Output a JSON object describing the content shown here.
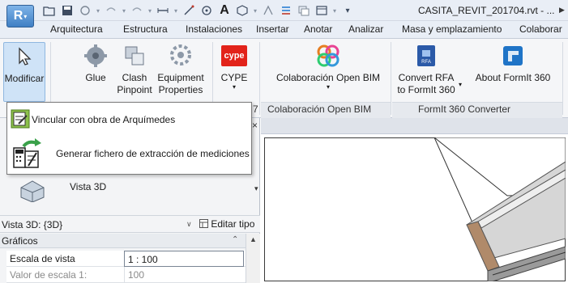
{
  "app": {
    "button_letter": "R",
    "title": "CASITA_REVIT_201704.rvt - ..."
  },
  "quick_access": {
    "icons": [
      "open-icon",
      "save-icon",
      "sync-icon",
      "undo-icon",
      "redo-icon",
      "measure-icon",
      "dimension-icon",
      "tag-icon",
      "text-icon",
      "3d-view-icon",
      "section-icon",
      "thin-lines-icon",
      "close-hidden-icon",
      "switch-windows-icon",
      "customize-icon"
    ],
    "text_tool_glyph": "A"
  },
  "tabs": [
    "Arquitectura",
    "Estructura",
    "Instalaciones",
    "Insertar",
    "Anotar",
    "Analizar",
    "Masa y emplazamiento",
    "Colaborar"
  ],
  "ribbon": {
    "modify": {
      "label": "Modificar"
    },
    "glue": {
      "label": "Glue"
    },
    "clash": {
      "line1": "Clash",
      "line2": "Pinpoint"
    },
    "equipment": {
      "line1": "Equipment",
      "line2": "Properties"
    },
    "cype": {
      "label": "CYPE",
      "logo_text": "cype"
    },
    "open_bim": {
      "label": "Colaboración Open BIM",
      "panel": "Colaboración Open BIM"
    },
    "convert_rfa": {
      "line1": "Convert RFA",
      "line2": "to FormIt 360"
    },
    "about_formit": {
      "label": "About FormIt 360"
    },
    "formit_panel": "FormIt 360 Converter",
    "cype_panel_suffix": "7"
  },
  "dropdown": {
    "items": [
      {
        "label": "Vincular con obra de Arquímedes",
        "icon": "link-arquimedes-icon"
      },
      {
        "label": "Generar fichero de extracción de mediciones",
        "icon": "extract-measurements-icon"
      }
    ]
  },
  "properties": {
    "close_glyph": "×",
    "view_type_label": "Vista 3D",
    "selector_label": "Vista 3D: {3D}",
    "edit_type_label": "Editar tipo",
    "group_label": "Gráficos",
    "rows": [
      {
        "name": "Escala de vista",
        "value": "1 : 100"
      },
      {
        "name": "Valor de escala    1:",
        "value": "100"
      }
    ]
  },
  "colors": {
    "ribbon_bg": "#f5f6f8",
    "tab_bg": "#e9eef6",
    "accent": "#2f5f96",
    "cype_red": "#e2231a"
  }
}
